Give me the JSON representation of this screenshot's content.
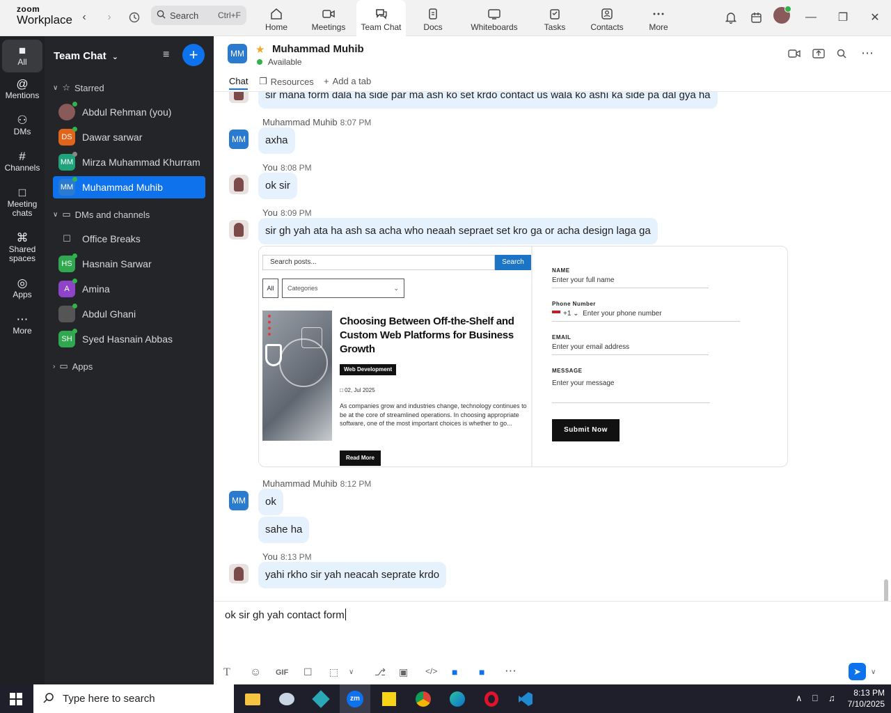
{
  "app": {
    "logo_line1": "zoom",
    "logo_line2": "Workplace"
  },
  "topbar": {
    "search_label": "Search",
    "search_shortcut": "Ctrl+F",
    "tabs": [
      {
        "label": "Home",
        "icon": "home-icon"
      },
      {
        "label": "Meetings",
        "icon": "video-icon"
      },
      {
        "label": "Team Chat",
        "icon": "chat-icon",
        "active": true
      },
      {
        "label": "Docs",
        "icon": "doc-icon"
      },
      {
        "label": "Whiteboards",
        "icon": "whiteboard-icon"
      },
      {
        "label": "Tasks",
        "icon": "tasks-icon"
      },
      {
        "label": "Contacts",
        "icon": "contacts-icon"
      },
      {
        "label": "More",
        "icon": "more-icon"
      }
    ]
  },
  "rail": {
    "items": [
      {
        "label": "All",
        "icon": "chat-bubble-icon",
        "active": true
      },
      {
        "label": "Mentions",
        "icon": "at-icon"
      },
      {
        "label": "DMs",
        "icon": "people-icon"
      },
      {
        "label": "Channels",
        "icon": "hash-icon"
      },
      {
        "label": "Meeting chats",
        "icon": "calendar-icon"
      },
      {
        "label": "Shared spaces",
        "icon": "share-icon"
      },
      {
        "label": "Apps",
        "icon": "apps-icon"
      },
      {
        "label": "More",
        "icon": "more-icon"
      }
    ]
  },
  "sidebar": {
    "title": "Team Chat",
    "starred_label": "Starred",
    "starred": [
      {
        "name": "Abdul Rehman (you)",
        "initials": "",
        "color": "#8a5a5a",
        "status": "online"
      },
      {
        "name": "Dawar sarwar",
        "initials": "DS",
        "color": "#e0641c",
        "status": "online"
      },
      {
        "name": "Mirza Muhammad Khurram",
        "initials": "MM",
        "color": "#1fa37a",
        "status": "away"
      },
      {
        "name": "Muhammad Muhib",
        "initials": "MM",
        "color": "#2a7ad0",
        "status": "online",
        "active": true
      }
    ],
    "dms_label": "DMs and channels",
    "dms": [
      {
        "name": "Office Breaks",
        "initials": "",
        "color": "transparent",
        "lock": true
      },
      {
        "name": "Hasnain Sarwar",
        "initials": "HS",
        "color": "#2fa84f",
        "status": "online"
      },
      {
        "name": "Amina",
        "initials": "A",
        "color": "#8e44c8",
        "status": "online"
      },
      {
        "name": "Abdul Ghani",
        "initials": "",
        "color": "#555555",
        "status": "online"
      },
      {
        "name": "Syed Hasnain Abbas",
        "initials": "SH",
        "color": "#2fa84f",
        "status": "online"
      }
    ],
    "apps_label": "Apps"
  },
  "chat_header": {
    "initials": "MM",
    "name": "Muhammad Muhib",
    "status": "Available",
    "tabs": [
      {
        "label": "Chat",
        "active": true
      },
      {
        "label": "Resources"
      },
      {
        "label": "Add a tab"
      }
    ]
  },
  "messages": [
    {
      "id": "m0",
      "text": "sir mana form dala ha side par ma ash ko set krdo contact us wala ko ashı ka side pa dal gya ha"
    },
    {
      "id": "m1",
      "sender": "Muhammad Muhib",
      "time": "8:07 PM",
      "text": "axha"
    },
    {
      "id": "m2",
      "sender": "You",
      "time": "8:08 PM",
      "text": "ok sir"
    },
    {
      "id": "m3",
      "sender": "You",
      "time": "8:09 PM",
      "text": "sir gh yah ata ha ash sa acha who neaah sepraet set kro ga or acha design laga ga"
    },
    {
      "id": "m4",
      "sender": "Muhammad Muhib",
      "time": "8:12 PM",
      "text": "ok"
    },
    {
      "id": "m5",
      "text": "sahe ha"
    },
    {
      "id": "m6",
      "sender": "You",
      "time": "8:13 PM",
      "text": "yahi rkho sir yah neacah seprate krdo"
    }
  ],
  "attachment": {
    "search_placeholder": "Search posts...",
    "search_button": "Search",
    "all_label": "All",
    "categories_label": "Categories",
    "post_title": "Choosing Between Off-the-Shelf and Custom Web Platforms for Business Growth",
    "post_tag": "Web Development",
    "post_date": "02, Jul 2025",
    "post_excerpt": "As companies grow and industries change, technology continues to be at the core of streamlined operations. In choosing appropriate software, one of the most important choices is whether to go...",
    "read_more": "Read More",
    "form": {
      "name_label": "NAME",
      "name_placeholder": "Enter your full name",
      "phone_label": "Phone Number",
      "phone_code": "+1",
      "phone_placeholder": "Enter your phone number",
      "email_label": "EMAIL",
      "email_placeholder": "Enter your email address",
      "message_label": "MESSAGE",
      "message_placeholder": "Enter your message",
      "submit": "Submit Now"
    }
  },
  "composer": {
    "draft": "ok sir gh yah contact form",
    "gif_label": "GIF"
  },
  "taskbar": {
    "search_placeholder": "Type here to search",
    "time": "8:13 PM",
    "date": "7/10/2025",
    "zoom_label": "zm"
  }
}
